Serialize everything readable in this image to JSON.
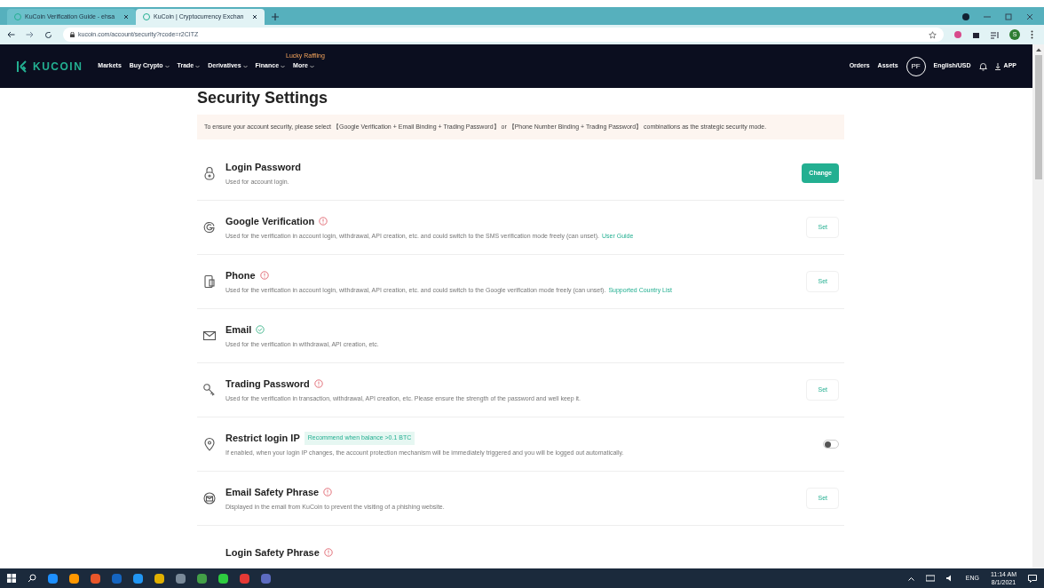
{
  "browser": {
    "tabs": [
      {
        "title": "KuCoin Verification Guide - ehsa",
        "selected": false
      },
      {
        "title": "KuCoin | Cryptocurrency Exchan",
        "selected": true
      }
    ],
    "url": "kucoin.com/account/security?rcode=r2CITZ",
    "profile": "S"
  },
  "nav": {
    "logo": "KUCOIN",
    "items": [
      {
        "label": "Markets",
        "caret": false
      },
      {
        "label": "Buy Crypto",
        "caret": true
      },
      {
        "label": "Trade",
        "caret": true
      },
      {
        "label": "Derivatives",
        "caret": true
      },
      {
        "label": "Finance",
        "caret": true
      },
      {
        "label": "More",
        "caret": true,
        "badge": "Lucky Raffling"
      }
    ],
    "right": [
      "Orders",
      "Assets"
    ],
    "avatar": "PF",
    "language": "English/USD",
    "app": "APP"
  },
  "page": {
    "title": "Security Settings",
    "notice": "To ensure your account security, please select 【Google Verification + Email Binding + Trading Password】 or 【Phone Number Binding + Trading Password】 combinations as the strategic security mode.",
    "settings": [
      {
        "title": "Login Password",
        "description": "Used for account login.",
        "action": {
          "kind": "primary",
          "label": "Change"
        }
      },
      {
        "title": "Google Verification",
        "verified": false,
        "description": "Used for the verification in account login, withdrawal, API creation, etc. and could switch to the SMS verification mode freely (can unset).",
        "link": "User Guide",
        "action": {
          "kind": "set",
          "label": "Set"
        }
      },
      {
        "title": "Phone",
        "verified": false,
        "description": "Used for the verification in account login, withdrawal, API creation, etc. and could switch to the Google verification mode freely (can unset).",
        "link": "Supported Country List",
        "action": {
          "kind": "set",
          "label": "Set"
        }
      },
      {
        "title": "Email",
        "verified": true,
        "description": "Used for the verification in withdrawal, API creation, etc."
      },
      {
        "title": "Trading Password",
        "verified": false,
        "description": "Used for the verification in transaction, withdrawal, API creation, etc. Please ensure the strength of the password and well keep it.",
        "action": {
          "kind": "set",
          "label": "Set"
        }
      },
      {
        "title": "Restrict login IP",
        "badge": "Recommend when balance >0.1 BTC",
        "description": "If enabled, when your login IP changes, the account protection mechanism will be immediately triggered and you will be logged out automatically.",
        "action": {
          "kind": "toggle",
          "on": false
        }
      },
      {
        "title": "Email Safety Phrase",
        "verified": false,
        "description": "Displayed in the email from KuCoin to prevent the visiting of a phishing website.",
        "action": {
          "kind": "set",
          "label": "Set"
        }
      },
      {
        "title": "Login Safety Phrase",
        "verified": false
      }
    ]
  },
  "taskbar": {
    "language": "ENG",
    "time": "11:14 AM",
    "date": "8/1/2021"
  }
}
